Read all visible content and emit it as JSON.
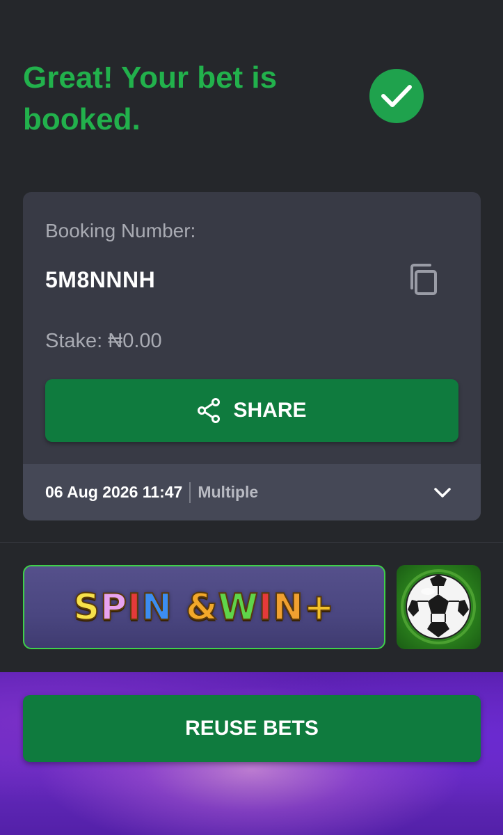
{
  "header": {
    "title": "Great! Your bet is booked.",
    "success_icon": "check-circle-icon",
    "accent_color": "#22b14c"
  },
  "booking_card": {
    "label": "Booking Number:",
    "booking_number": "5M8NNNH",
    "copy_icon": "copy-icon",
    "stake": "Stake: ₦0.00",
    "share_label": "SHARE",
    "share_icon": "share-icon",
    "footer": {
      "date_time": "06 Aug 2026 11:47",
      "bet_type": "Multiple",
      "expand_icon": "chevron-down-icon"
    }
  },
  "promos": {
    "spin_win": {
      "letters": [
        "S",
        "P",
        "I",
        "N",
        " ",
        "&",
        "W",
        "I",
        "N",
        "+"
      ],
      "colors": [
        "#f7e14a",
        "#e8a3f0",
        "#e53a3a",
        "#3c8df0",
        "",
        "#f2a82a",
        "#5fd44a",
        "#e53a3a",
        "#f0a030",
        "#f2c02a"
      ]
    },
    "football_icon": "soccer-ball-icon"
  },
  "actions": {
    "reuse_label": "REUSE BETS",
    "button_color": "#0f7b3e"
  }
}
